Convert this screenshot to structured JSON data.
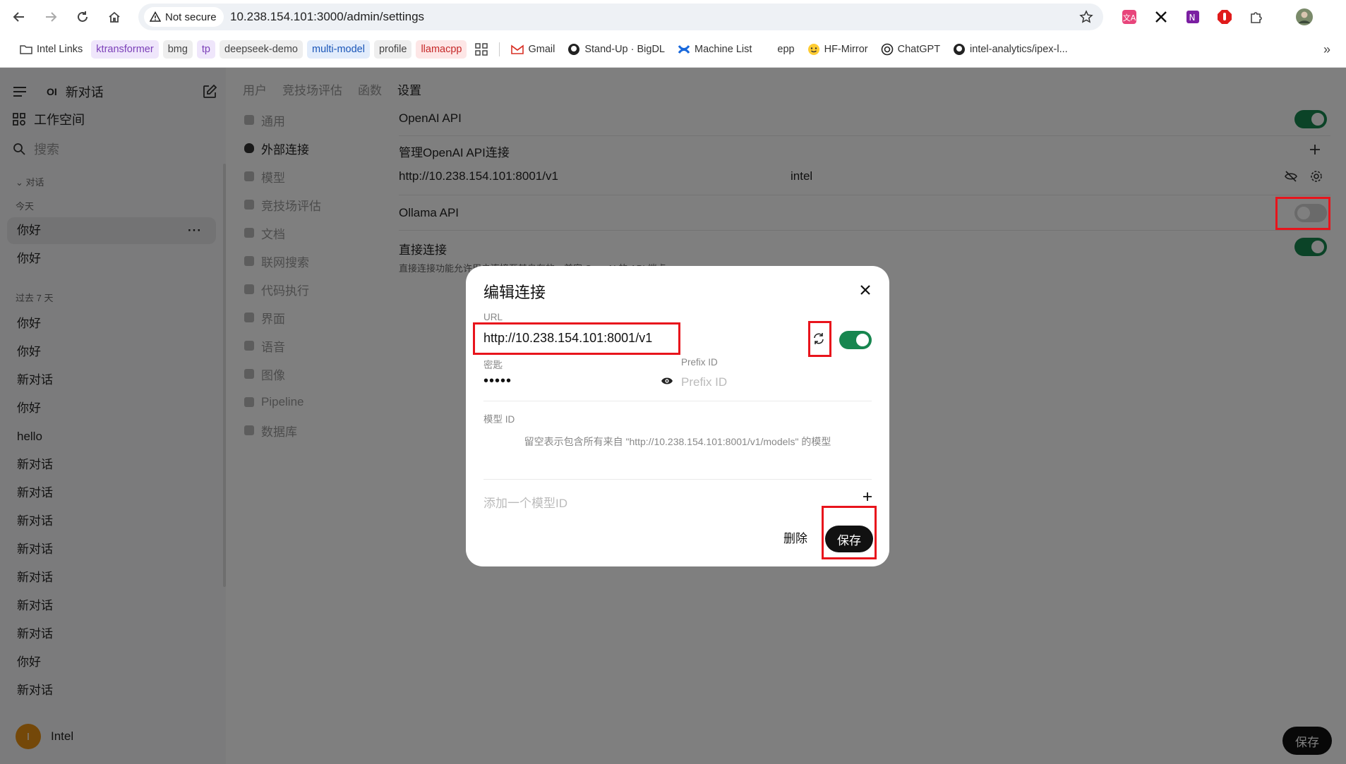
{
  "browser": {
    "security_label": "Not secure",
    "url": "10.238.154.101:3000/admin/settings",
    "bookmarks": [
      {
        "label": "Intel Links",
        "kind": "folder"
      },
      {
        "label": "ktransformer",
        "kind": "tag",
        "color": "#7b3fb8",
        "bg": "#efe6fb"
      },
      {
        "label": "bmg",
        "kind": "tag",
        "color": "#444",
        "bg": "#eeeeee"
      },
      {
        "label": "tp",
        "kind": "tag",
        "color": "#7b3fb8",
        "bg": "#efe6fb"
      },
      {
        "label": "deepseek-demo",
        "kind": "tag",
        "color": "#444",
        "bg": "#eeeeee"
      },
      {
        "label": "multi-model",
        "kind": "tag",
        "color": "#1a56b8",
        "bg": "#e2ecfb"
      },
      {
        "label": "profile",
        "kind": "tag",
        "color": "#444",
        "bg": "#eeeeee"
      },
      {
        "label": "llamacpp",
        "kind": "tag",
        "color": "#c62828",
        "bg": "#fde6e6"
      },
      {
        "label": "Gmail",
        "kind": "link"
      },
      {
        "label": "Stand-Up · BigDL",
        "kind": "link"
      },
      {
        "label": "Machine List",
        "kind": "link"
      },
      {
        "label": "epp",
        "kind": "link"
      },
      {
        "label": "HF-Mirror",
        "kind": "link"
      },
      {
        "label": "ChatGPT",
        "kind": "link"
      },
      {
        "label": "intel-analytics/ipex-l...",
        "kind": "link"
      }
    ]
  },
  "sidebar": {
    "logo": "OI",
    "new_chat": "新对话",
    "workspace": "工作空间",
    "search_placeholder": "搜索",
    "section_chats": "对话",
    "section_today": "今天",
    "today_items": [
      "你好",
      "你好"
    ],
    "section_week": "过去 7 天",
    "week_items": [
      "你好",
      "你好",
      "新对话",
      "你好",
      "hello",
      "新对话",
      "新对话",
      "新对话",
      "新对话",
      "新对话",
      "新对话",
      "新对话",
      "你好",
      "新对话"
    ],
    "user_initial": "I",
    "user_name": "Intel"
  },
  "top_tabs": [
    "用户",
    "竞技场评估",
    "函数",
    "设置"
  ],
  "settings_nav": [
    "通用",
    "外部连接",
    "模型",
    "竞技场评估",
    "文档",
    "联网搜索",
    "代码执行",
    "界面",
    "语音",
    "图像",
    "Pipeline",
    "数据库"
  ],
  "settings": {
    "openai_api_label": "OpenAI API",
    "openai_api_enabled": true,
    "manage_openai_label": "管理OpenAI API连接",
    "connection_url": "http://10.238.154.101:8001/v1",
    "connection_tag": "intel",
    "ollama_api_label": "Ollama API",
    "ollama_api_enabled": false,
    "direct_label": "直接连接",
    "direct_note": "直接连接功能允许用户连接至其自有的，兼容 OpenAI 的 API 端点。",
    "direct_enabled": true,
    "save_label": "保存"
  },
  "modal": {
    "title": "编辑连接",
    "url_label": "URL",
    "url_value": "http://10.238.154.101:8001/v1",
    "connection_enabled": true,
    "key_label": "密匙",
    "key_value": "•••••",
    "prefix_label": "Prefix ID",
    "prefix_placeholder": "Prefix ID",
    "model_id_label": "模型 ID",
    "model_id_note": "留空表示包含所有来自 \"http://10.238.154.101:8001/v1/models\" 的模型",
    "add_model_placeholder": "添加一个模型ID",
    "delete_label": "删除",
    "save_label": "保存"
  },
  "colors": {
    "toggle_on": "#17864f",
    "toggle_off": "#d4d4d4",
    "highlight": "#e8141c"
  }
}
